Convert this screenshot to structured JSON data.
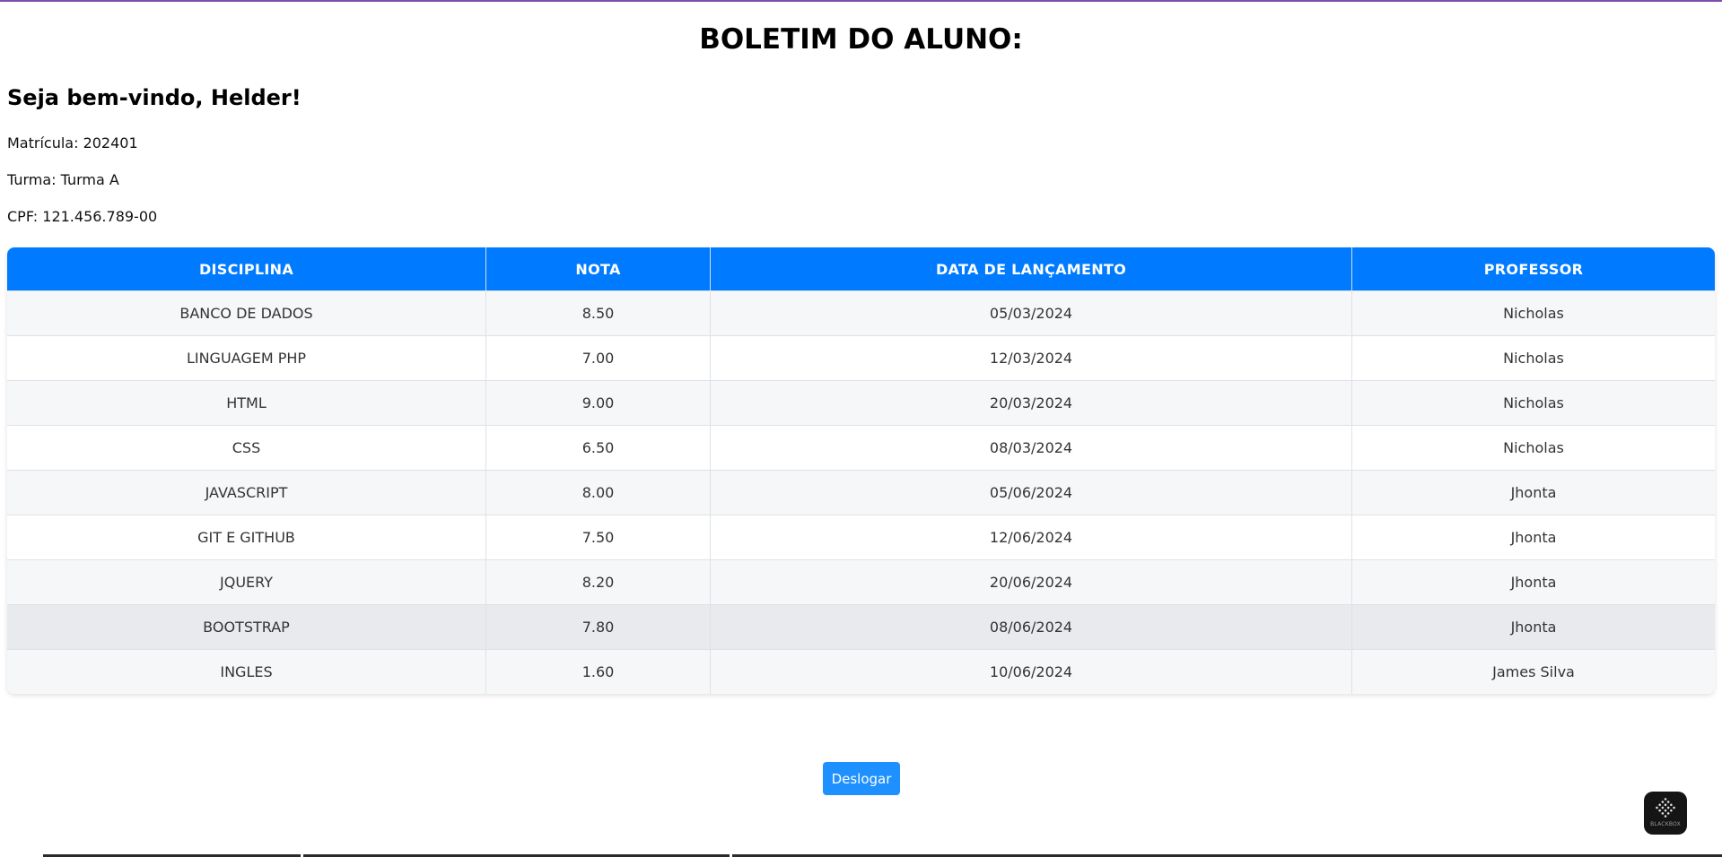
{
  "page": {
    "title": "BOLETIM DO ALUNO:",
    "welcome": "Seja bem-vindo, Helder!",
    "matricula": "Matrícula: 202401",
    "turma": "Turma: Turma A",
    "cpf": "CPF: 121.456.789-00"
  },
  "table": {
    "headers": [
      "DISCIPLINA",
      "NOTA",
      "DATA DE LANÇAMENTO",
      "PROFESSOR"
    ],
    "rows": [
      [
        "BANCO DE DADOS",
        "8.50",
        "05/03/2024",
        "Nicholas"
      ],
      [
        "LINGUAGEM PHP",
        "7.00",
        "12/03/2024",
        "Nicholas"
      ],
      [
        "HTML",
        "9.00",
        "20/03/2024",
        "Nicholas"
      ],
      [
        "CSS",
        "6.50",
        "08/03/2024",
        "Nicholas"
      ],
      [
        "JAVASCRIPT",
        "8.00",
        "05/06/2024",
        "Jhonta"
      ],
      [
        "GIT E GITHUB",
        "7.50",
        "12/06/2024",
        "Jhonta"
      ],
      [
        "JQUERY",
        "8.20",
        "20/06/2024",
        "Jhonta"
      ],
      [
        "BOOTSTRAP",
        "7.80",
        "08/06/2024",
        "Jhonta"
      ],
      [
        "INGLES",
        "1.60",
        "10/06/2024",
        "James Silva"
      ]
    ]
  },
  "actions": {
    "logout_label": "Deslogar"
  },
  "widget": {
    "label": "BLACKBOX",
    "icon": "blackbox-logo-icon"
  },
  "colors": {
    "accent": "#007bff",
    "button": "#1e90ff",
    "top_border": "#7b4fb0"
  }
}
